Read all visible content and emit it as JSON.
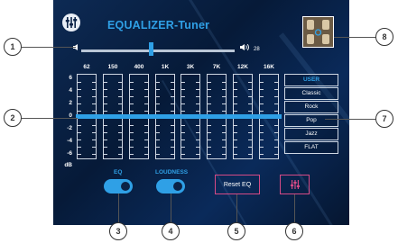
{
  "header": {
    "title": "EQUALIZER-Tuner"
  },
  "volume": {
    "value": "28",
    "level": 0.45
  },
  "eq": {
    "frequencies": [
      "62",
      "150",
      "400",
      "1K",
      "3K",
      "7K",
      "12K",
      "16K"
    ],
    "db_scale": [
      "6",
      "4",
      "2",
      "0",
      "-2",
      "-4",
      "-6"
    ],
    "db_unit": "dB"
  },
  "presets": {
    "selected": "USER",
    "items": [
      "USER",
      "Classic",
      "Rock",
      "Pop",
      "Jazz",
      "FLAT"
    ]
  },
  "controls": {
    "eq_label": "EQ",
    "eq_on": true,
    "loudness_label": "LOUDNESS",
    "loudness_on": true,
    "reset_label": "Reset EQ"
  },
  "callouts": [
    "1",
    "2",
    "3",
    "4",
    "5",
    "6",
    "7",
    "8"
  ],
  "colors": {
    "accent": "#2fa0e6",
    "button_border": "#d64a86",
    "background": "#0a2348"
  },
  "icons": {
    "volume_low": "speaker-low-icon",
    "volume_high": "speaker-high-icon",
    "settings": "equalizer-sliders-icon",
    "logo": "equalizer-logo-icon"
  }
}
